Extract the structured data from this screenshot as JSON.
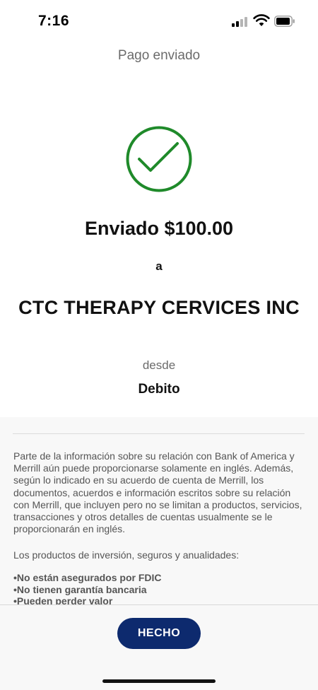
{
  "status_bar": {
    "time": "7:16",
    "icons": [
      "signal-icon",
      "wifi-icon",
      "battery-icon"
    ]
  },
  "header": {
    "title": "Pago enviado"
  },
  "confirmation": {
    "icon": "checkmark-circle-icon",
    "icon_color": "#1f8a2a",
    "sent_amount": "Enviado $100.00",
    "to_label": "a",
    "recipient": "CTC THERAPY CERVICES INC",
    "from_label": "desde",
    "account": "Debito"
  },
  "disclosure": {
    "paragraph": "Parte de la información sobre su relación con Bank of America y Merrill aún puede proporcionarse solamente en inglés. Además, según lo indicado en su acuerdo de cuenta de Merrill, los documentos, acuerdos e información escritos sobre su relación con Merrill, que incluyen pero no se limitan a productos, servicios, transacciones y otros detalles de cuentas usualmente se le proporcionarán en inglés.",
    "products_heading": "Los productos de inversión, seguros y anualidades:",
    "bullets": [
      "No están asegurados por FDIC",
      "No tienen garantía bancaria",
      "Pueden perder valor"
    ]
  },
  "footer": {
    "done_label": "HECHO",
    "button_color": "#0d2a6e"
  }
}
